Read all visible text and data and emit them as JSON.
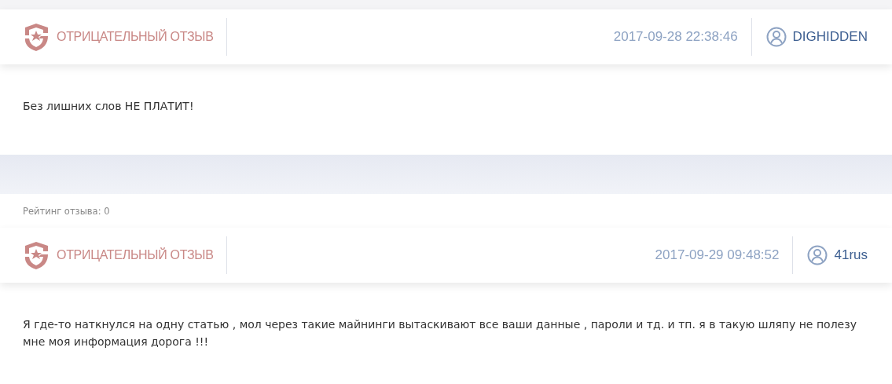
{
  "reviews": [
    {
      "kind": "negative",
      "type_label": "ОТРИЦАТЕЛЬНЫЙ ОТЗЫВ",
      "date": "2017-09-28 22:38:46",
      "user": "DIGHIDDEN",
      "text": "Без лишних слов НЕ ПЛАТИТ!",
      "rating": "Рейтинг отзыва: 0"
    },
    {
      "kind": "negative",
      "type_label": "ОТРИЦАТЕЛЬНЫЙ ОТЗЫВ",
      "date": "2017-09-29 09:48:52",
      "user": "41rus",
      "text": "Я где-то наткнулся на одну статью , мол через такие майнинги вытаскивают все ваши данные , пароли и тд. и тп. я в такую шляпу не полезу мне моя информация дорога !!!"
    }
  ]
}
